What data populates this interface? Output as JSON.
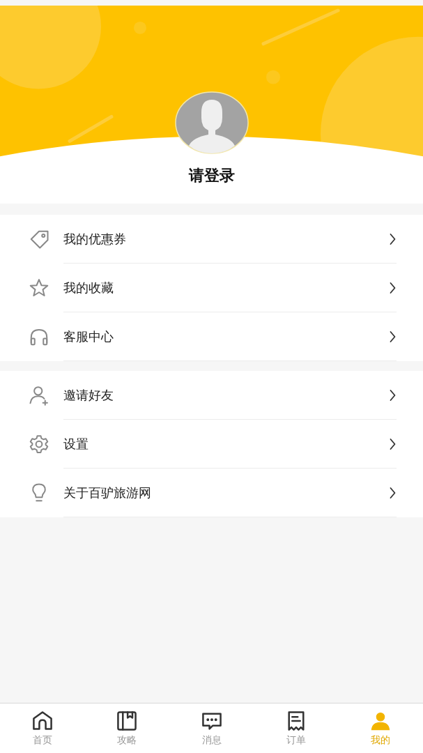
{
  "profile": {
    "login_prompt": "请登录"
  },
  "menu_groups": [
    {
      "items": [
        {
          "label": "我的优惠券"
        },
        {
          "label": "我的收藏"
        },
        {
          "label": "客服中心"
        }
      ]
    },
    {
      "items": [
        {
          "label": "邀请好友"
        },
        {
          "label": "设置"
        },
        {
          "label": "关于百驴旅游网"
        }
      ]
    }
  ],
  "tab_bar": [
    {
      "label": "首页",
      "selected": false
    },
    {
      "label": "攻略",
      "selected": false
    },
    {
      "label": "消息",
      "selected": false
    },
    {
      "label": "订单",
      "selected": false
    },
    {
      "label": "我的",
      "selected": true
    }
  ]
}
